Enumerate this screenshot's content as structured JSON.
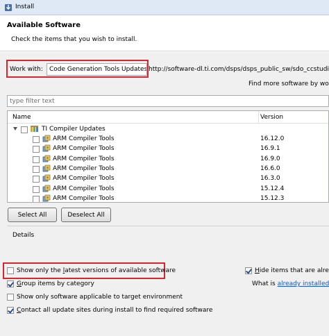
{
  "window": {
    "title": "Install"
  },
  "header": {
    "title": "Available Software",
    "subtitle": "Check the items that you wish to install."
  },
  "work_with": {
    "label": "Work with:",
    "value": "Code Generation Tools Updates -",
    "url": "http://software-dl.ti.com/dsps/dsps_public_sw/sdo_ccstudio/"
  },
  "find_more": "Find more software by wo",
  "filter": {
    "placeholder": "type filter text"
  },
  "tree": {
    "columns": [
      "Name",
      "Version"
    ],
    "category": {
      "label": "TI Compiler Updates",
      "checked": false
    },
    "items": [
      {
        "name": "ARM Compiler Tools",
        "version": "16.12.0",
        "checked": false
      },
      {
        "name": "ARM Compiler Tools",
        "version": "16.9.1",
        "checked": false
      },
      {
        "name": "ARM Compiler Tools",
        "version": "16.9.0",
        "checked": false
      },
      {
        "name": "ARM Compiler Tools",
        "version": "16.6.0",
        "checked": false
      },
      {
        "name": "ARM Compiler Tools",
        "version": "16.3.0",
        "checked": false
      },
      {
        "name": "ARM Compiler Tools",
        "version": "15.12.4",
        "checked": false
      },
      {
        "name": "ARM Compiler Tools",
        "version": "15.12.3",
        "checked": false
      }
    ]
  },
  "buttons": {
    "select_all": "Select All",
    "deselect_all": "Deselect All"
  },
  "details": {
    "label": "Details"
  },
  "options": {
    "latest_only": {
      "label": "Show only the latest versions of available software",
      "checked": false
    },
    "hide_installed": {
      "label": "Hide items that are alread",
      "checked": true
    },
    "group_by_category": {
      "label": "Group items by category",
      "checked": true
    },
    "target_env": {
      "label": "Show only software applicable to target environment",
      "checked": false
    },
    "contact_sites": {
      "label": "Contact all update sites during install to find required software",
      "checked": true
    }
  },
  "what_is": {
    "prefix": "What is ",
    "link": "already installed",
    "suffix": "?"
  },
  "icons": {
    "app": "install-icon",
    "category": "category-folder-icon",
    "feature": "feature-plugin-icon"
  },
  "colors": {
    "highlight_box": "#d9262c",
    "link": "#1a56c4"
  }
}
